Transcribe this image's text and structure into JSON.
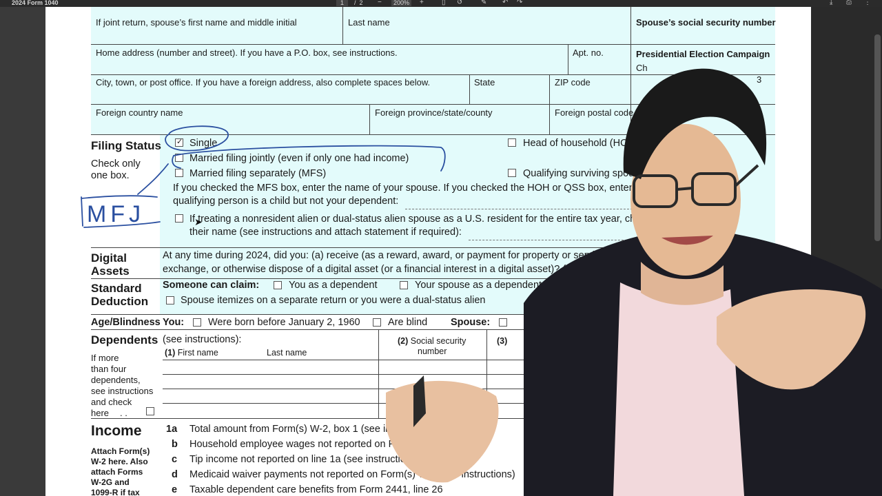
{
  "viewer": {
    "title": "2024 Form 1040",
    "page_current": "1",
    "page_sep": "/",
    "page_total": "2",
    "zoom": "200%",
    "icons": [
      "zoom-out-icon",
      "zoom-in-icon",
      "fit-page-icon",
      "rotate-icon",
      "draw-icon",
      "undo-icon",
      "redo-icon",
      "download-icon",
      "print-icon",
      "more-icon"
    ]
  },
  "form": {
    "spouse_name": "If joint return, spouse’s first name and middle initial",
    "last_name": "Last name",
    "spouse_ssn": "Spouse’s social security number",
    "home_address": "Home address (number and street). If you have a P.O. box, see instructions.",
    "apt_no": "Apt. no.",
    "presidential": "Presidential Election Campaign",
    "pres_line2": "Ch",
    "pres_digit": "3",
    "city": "City, town, or post office. If you have a foreign address, also complete spaces below.",
    "state": "State",
    "zip": "ZIP code",
    "foreign_country": "Foreign country name",
    "foreign_province": "Foreign province/state/county",
    "foreign_postal": "Foreign postal code",
    "filing_status": {
      "heading": "Filing Status",
      "note1": "Check only",
      "note2": "one box.",
      "single": "Single",
      "mfj": "Married filing jointly (even if only one had income)",
      "mfs": "Married filing separately (MFS)",
      "hoh": "Head of household (HOH)",
      "qss": "Qualifying surviving spouse (QSS)",
      "mfs_note1": "If you checked the MFS box, enter the name of your spouse. If you checked the HOH or QSS box, enter the child’s name if the",
      "mfs_note2": "qualifying person is a child but not your dependent:",
      "nra1": "If treating a nonresident alien or dual-status alien spouse as a U.S. resident for the entire tax year, check the box and enter",
      "nra2": "their name (see instructions and attach statement if required):"
    },
    "digital": {
      "h1": "Digital",
      "h2": "Assets",
      "l1": "At any time during 2024, did you: (a) receive (as a reward, award, or payment for property or services); or (b) sell,",
      "l2": "exchange, or otherwise dispose of a digital asset (or a financial interest in a digital asset)? (See instructions.)"
    },
    "standard": {
      "h1": "Standard",
      "h2": "Deduction",
      "someone": "Someone can claim:",
      "you_dep": "You as a dependent",
      "spouse_dep": "Your spouse as a dependent",
      "itemizes": "Spouse itemizes on a separate return or you were a dual-status alien"
    },
    "age": {
      "heading": "Age/Blindness",
      "you": "You:",
      "born": "Were born before January 2, 1960",
      "blind": "Are blind",
      "spouse": "Spouse:"
    },
    "dependents": {
      "heading": "Dependents",
      "see": "(see instructions):",
      "col1_num": "(1)",
      "col1": "First name",
      "col1_last": "Last name",
      "col2_num": "(2)",
      "col2a": "Social security",
      "col2b": "number",
      "col3_num": "(3)",
      "side1": "If more",
      "side2": "than four",
      "side3": "dependents,",
      "side4": "see instructions",
      "side5": "and check",
      "side6": "here",
      "side_dots": ". ."
    },
    "income": {
      "heading": "Income",
      "a1": "Attach Form(s)",
      "a2": "W-2 here. Also",
      "a3": "attach Forms",
      "a4": "W-2G and",
      "a5": "1099-R if tax",
      "lines": [
        {
          "num": "1a",
          "text": "Total amount from Form(s) W-2, box 1 (see instructions)"
        },
        {
          "num": "b",
          "text": "Household employee wages not reported on Form(s) W-2"
        },
        {
          "num": "c",
          "text": "Tip income not reported on line 1a (see instructions)"
        },
        {
          "num": "d",
          "text": "Medicaid waiver payments not reported on Form(s) W-2 (see instructions)"
        },
        {
          "num": "e",
          "text": "Taxable dependent care benefits from Form 2441, line 26"
        }
      ]
    }
  },
  "annotation": {
    "ink_text": "MFJ",
    "ink_color": "#2a4fa0"
  },
  "colors": {
    "form_tint": "#e3fbfb",
    "toolbar_bg": "#2b2b2b",
    "viewer_bg": "#3a3a3a"
  }
}
